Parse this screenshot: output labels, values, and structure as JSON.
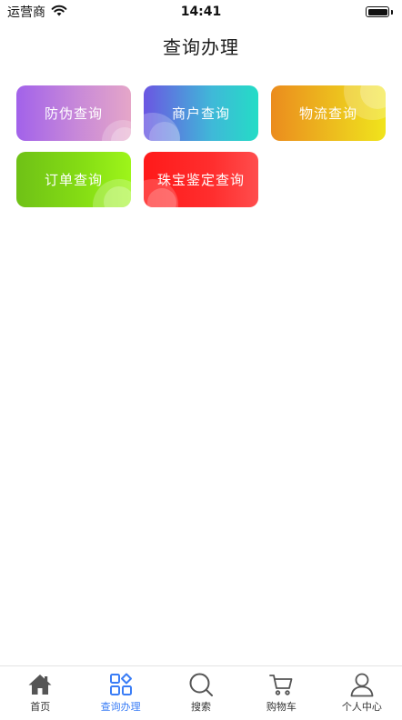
{
  "status_bar": {
    "carrier": "运营商",
    "time": "14:41",
    "battery_level": 1.0
  },
  "page": {
    "title": "查询办理"
  },
  "tiles": [
    {
      "label": "防伪查询",
      "icon": "none"
    },
    {
      "label": "商户查询",
      "icon": "none"
    },
    {
      "label": "物流查询",
      "icon": "none"
    },
    {
      "label": "订单查询",
      "icon": "none"
    },
    {
      "label": "珠宝鉴定查询",
      "icon": "none"
    }
  ],
  "tab_bar": {
    "active_index": 1,
    "active_color": "#3a7df6",
    "inactive_color": "#555555",
    "items": [
      {
        "label": "首页",
        "icon": "home-icon"
      },
      {
        "label": "查询办理",
        "icon": "grid-diamond-icon"
      },
      {
        "label": "搜索",
        "icon": "search-icon"
      },
      {
        "label": "购物车",
        "icon": "cart-icon"
      },
      {
        "label": "个人中心",
        "icon": "user-icon"
      }
    ]
  }
}
